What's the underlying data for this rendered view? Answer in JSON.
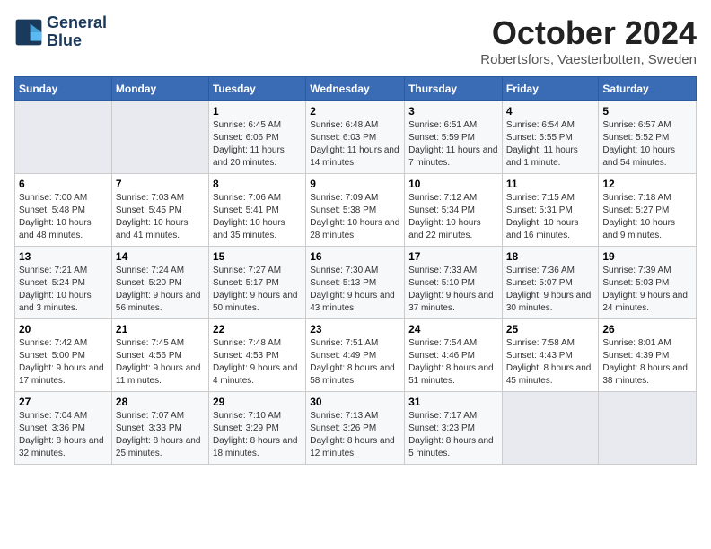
{
  "header": {
    "logo_line1": "General",
    "logo_line2": "Blue",
    "title": "October 2024",
    "subtitle": "Robertsfors, Vaesterbotten, Sweden"
  },
  "columns": [
    "Sunday",
    "Monday",
    "Tuesday",
    "Wednesday",
    "Thursday",
    "Friday",
    "Saturday"
  ],
  "weeks": [
    [
      {
        "day": "",
        "info": ""
      },
      {
        "day": "",
        "info": ""
      },
      {
        "day": "1",
        "info": "Sunrise: 6:45 AM\nSunset: 6:06 PM\nDaylight: 11 hours and 20 minutes."
      },
      {
        "day": "2",
        "info": "Sunrise: 6:48 AM\nSunset: 6:03 PM\nDaylight: 11 hours and 14 minutes."
      },
      {
        "day": "3",
        "info": "Sunrise: 6:51 AM\nSunset: 5:59 PM\nDaylight: 11 hours and 7 minutes."
      },
      {
        "day": "4",
        "info": "Sunrise: 6:54 AM\nSunset: 5:55 PM\nDaylight: 11 hours and 1 minute."
      },
      {
        "day": "5",
        "info": "Sunrise: 6:57 AM\nSunset: 5:52 PM\nDaylight: 10 hours and 54 minutes."
      }
    ],
    [
      {
        "day": "6",
        "info": "Sunrise: 7:00 AM\nSunset: 5:48 PM\nDaylight: 10 hours and 48 minutes."
      },
      {
        "day": "7",
        "info": "Sunrise: 7:03 AM\nSunset: 5:45 PM\nDaylight: 10 hours and 41 minutes."
      },
      {
        "day": "8",
        "info": "Sunrise: 7:06 AM\nSunset: 5:41 PM\nDaylight: 10 hours and 35 minutes."
      },
      {
        "day": "9",
        "info": "Sunrise: 7:09 AM\nSunset: 5:38 PM\nDaylight: 10 hours and 28 minutes."
      },
      {
        "day": "10",
        "info": "Sunrise: 7:12 AM\nSunset: 5:34 PM\nDaylight: 10 hours and 22 minutes."
      },
      {
        "day": "11",
        "info": "Sunrise: 7:15 AM\nSunset: 5:31 PM\nDaylight: 10 hours and 16 minutes."
      },
      {
        "day": "12",
        "info": "Sunrise: 7:18 AM\nSunset: 5:27 PM\nDaylight: 10 hours and 9 minutes."
      }
    ],
    [
      {
        "day": "13",
        "info": "Sunrise: 7:21 AM\nSunset: 5:24 PM\nDaylight: 10 hours and 3 minutes."
      },
      {
        "day": "14",
        "info": "Sunrise: 7:24 AM\nSunset: 5:20 PM\nDaylight: 9 hours and 56 minutes."
      },
      {
        "day": "15",
        "info": "Sunrise: 7:27 AM\nSunset: 5:17 PM\nDaylight: 9 hours and 50 minutes."
      },
      {
        "day": "16",
        "info": "Sunrise: 7:30 AM\nSunset: 5:13 PM\nDaylight: 9 hours and 43 minutes."
      },
      {
        "day": "17",
        "info": "Sunrise: 7:33 AM\nSunset: 5:10 PM\nDaylight: 9 hours and 37 minutes."
      },
      {
        "day": "18",
        "info": "Sunrise: 7:36 AM\nSunset: 5:07 PM\nDaylight: 9 hours and 30 minutes."
      },
      {
        "day": "19",
        "info": "Sunrise: 7:39 AM\nSunset: 5:03 PM\nDaylight: 9 hours and 24 minutes."
      }
    ],
    [
      {
        "day": "20",
        "info": "Sunrise: 7:42 AM\nSunset: 5:00 PM\nDaylight: 9 hours and 17 minutes."
      },
      {
        "day": "21",
        "info": "Sunrise: 7:45 AM\nSunset: 4:56 PM\nDaylight: 9 hours and 11 minutes."
      },
      {
        "day": "22",
        "info": "Sunrise: 7:48 AM\nSunset: 4:53 PM\nDaylight: 9 hours and 4 minutes."
      },
      {
        "day": "23",
        "info": "Sunrise: 7:51 AM\nSunset: 4:49 PM\nDaylight: 8 hours and 58 minutes."
      },
      {
        "day": "24",
        "info": "Sunrise: 7:54 AM\nSunset: 4:46 PM\nDaylight: 8 hours and 51 minutes."
      },
      {
        "day": "25",
        "info": "Sunrise: 7:58 AM\nSunset: 4:43 PM\nDaylight: 8 hours and 45 minutes."
      },
      {
        "day": "26",
        "info": "Sunrise: 8:01 AM\nSunset: 4:39 PM\nDaylight: 8 hours and 38 minutes."
      }
    ],
    [
      {
        "day": "27",
        "info": "Sunrise: 7:04 AM\nSunset: 3:36 PM\nDaylight: 8 hours and 32 minutes."
      },
      {
        "day": "28",
        "info": "Sunrise: 7:07 AM\nSunset: 3:33 PM\nDaylight: 8 hours and 25 minutes."
      },
      {
        "day": "29",
        "info": "Sunrise: 7:10 AM\nSunset: 3:29 PM\nDaylight: 8 hours and 18 minutes."
      },
      {
        "day": "30",
        "info": "Sunrise: 7:13 AM\nSunset: 3:26 PM\nDaylight: 8 hours and 12 minutes."
      },
      {
        "day": "31",
        "info": "Sunrise: 7:17 AM\nSunset: 3:23 PM\nDaylight: 8 hours and 5 minutes."
      },
      {
        "day": "",
        "info": ""
      },
      {
        "day": "",
        "info": ""
      }
    ]
  ]
}
